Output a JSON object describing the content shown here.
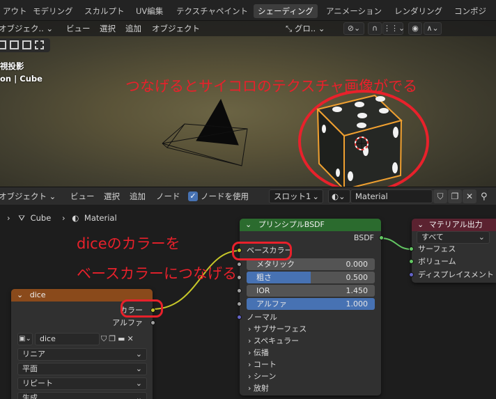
{
  "workspace_tabs": [
    {
      "label": "アウト",
      "active": false
    },
    {
      "label": "モデリング",
      "active": false
    },
    {
      "label": "スカルプト",
      "active": false
    },
    {
      "label": "UV編集",
      "active": false
    },
    {
      "label": "テクスチャペイント",
      "active": false
    },
    {
      "label": "シェーディング",
      "active": true
    },
    {
      "label": "アニメーション",
      "active": false
    },
    {
      "label": "レンダリング",
      "active": false
    },
    {
      "label": "コンポジ",
      "active": false
    }
  ],
  "viewport": {
    "mode_label": "オブジェク..",
    "menu": [
      "ビュー",
      "選択",
      "追加",
      "オブジェクト"
    ],
    "transform_orientation": "グロ..",
    "info_line1": "視投影",
    "info_line2": "on | Cube",
    "annotation": "つなげるとサイコロのテクスチャ画像がでる"
  },
  "node_editor": {
    "mode_label": "オブジェクト",
    "menu": [
      "ビュー",
      "選択",
      "追加",
      "ノード"
    ],
    "use_nodes_label": "ノードを使用",
    "slot_label": "スロット1",
    "material_name": "Material",
    "breadcrumb": {
      "object": "Cube",
      "material": "Material"
    },
    "annotation_1": "diceのカラーを",
    "annotation_2": "ベースカラーにつなげる",
    "dice_node": {
      "title": "dice",
      "out_color": "カラー",
      "out_alpha": "アルファ",
      "image_name": "dice",
      "interpolation": "リニア",
      "projection": "平面",
      "extension": "リピート",
      "source": "生成"
    },
    "bsdf_node": {
      "title": "プリンシプルBSDF",
      "output": "BSDF",
      "base_color": "ベースカラー",
      "metallic_label": "メタリック",
      "metallic_value": "0.000",
      "roughness_label": "粗さ",
      "roughness_value": "0.500",
      "ior_label": "IOR",
      "ior_value": "1.450",
      "alpha_label": "アルファ",
      "alpha_value": "1.000",
      "normal": "ノーマル",
      "panels": [
        "サブサーフェス",
        "スペキュラー",
        "伝播",
        "コート",
        "シーン",
        "放射"
      ]
    },
    "output_node": {
      "title": "マテリアル出力",
      "target": "すべて",
      "surface": "サーフェス",
      "volume": "ボリューム",
      "displacement": "ディスプレイスメント"
    }
  },
  "colors": {
    "annotation_red": "#e8212b",
    "image_node_header": "#8a4a1b",
    "shader_node_header": "#2b6b2e",
    "output_node_header": "#5b2230",
    "color_socket": "#c7c729",
    "shader_socket": "#63c763",
    "vector_socket": "#6363c7",
    "float_socket": "#a1a1a1",
    "field_blue": "#4772b3"
  }
}
